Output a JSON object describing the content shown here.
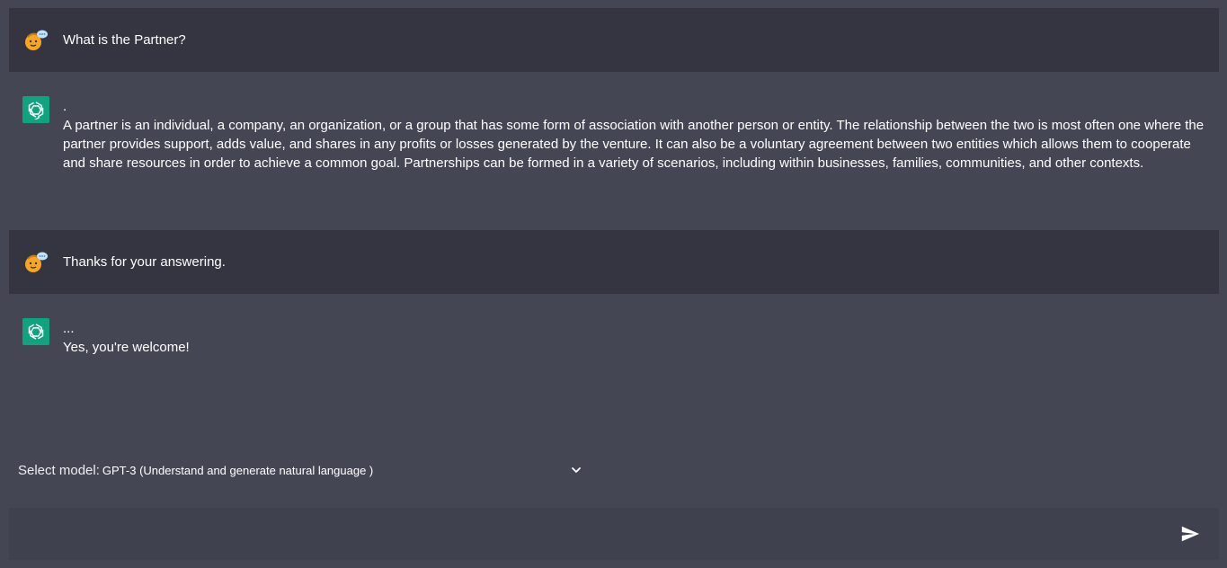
{
  "conversation": [
    {
      "role": "user",
      "avatar_icon": "user-avatar-icon",
      "text": "What is the Partner?"
    },
    {
      "role": "assistant",
      "avatar_icon": "openai-logo-icon",
      "prefix": ".",
      "text": "A partner is an individual, a company, an organization, or a group that has some form of association with another person or entity. The relationship between the two is most often one where the partner provides support, adds value, and shares in any profits or losses generated by the venture. It can also be a voluntary agreement between two entities which allows them to cooperate and share resources in order to achieve a common goal. Partnerships can be formed in a variety of scenarios, including within businesses, families, communities, and other contexts."
    },
    {
      "role": "user",
      "avatar_icon": "user-avatar-icon",
      "text": "Thanks for your answering."
    },
    {
      "role": "assistant",
      "avatar_icon": "openai-logo-icon",
      "prefix": "...",
      "text": "Yes, you're welcome!"
    }
  ],
  "model_selector": {
    "label": "Select model:",
    "selected": "GPT-3 (Understand and generate natural language )",
    "icon": "chevron-down-icon"
  },
  "prompt": {
    "value": "",
    "placeholder": "",
    "send_icon": "send-icon"
  },
  "colors": {
    "background": "#444654",
    "user_row": "#343541",
    "input_bar": "#40414f",
    "assistant_accent": "#10a37f",
    "text": "#ffffff"
  }
}
